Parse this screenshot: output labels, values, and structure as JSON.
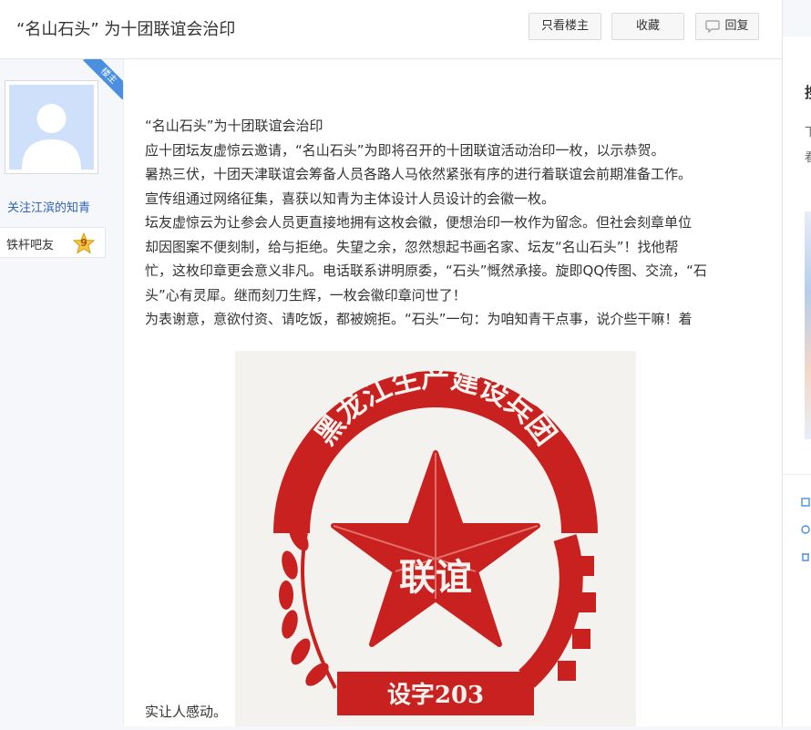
{
  "header": {
    "title": "“名山石头” 为十团联谊会治印",
    "btn_only_op": "只看楼主",
    "btn_favorite": "收藏",
    "btn_reply": "回复"
  },
  "author": {
    "badge": "楼主",
    "follow_text": "关注江滨的知青",
    "level_name": "铁杆吧友",
    "level_num": "9"
  },
  "post": {
    "lines": [
      "“名山石头”为十团联谊会治印",
      "应十团坛友虚惊云邀请，“名山石头”为即将召开的十团联谊活动治印一枚，以示恭贺。",
      "暑热三伏，十团天津联谊会筹备人员各路人马依然紧张有序的进行着联谊会前期准备工作。",
      "宣传组通过网络征集，喜获以知青为主体设计人员设计的会徽一枚。",
      "坛友虚惊云为让参会人员更直接地拥有这枚会徽，便想治印一枚作为留念。但社会刻章单位",
      "却因图案不便刻制，给与拒绝。失望之余，忽然想起书画名家、坛友“名山石头”！找他帮",
      "忙，这枚印章更会意义非凡。电话联系讲明原委，“石头”慨然承接。旋即QQ传图、交流，“石",
      "头”心有灵犀。继而刻刀生辉，一枚会徽印章问世了！",
      "为表谢意，意欲付资、请吃饭，都被婉拒。“石头”一句：为咱知青干点事，说介些干嘛！着"
    ],
    "last_line": "实让人感动。"
  },
  "seal": {
    "arc_text": "黑龙江生产建设兵团",
    "center_text": "联谊",
    "bottom_text": "设字203",
    "color": "#c8211f"
  },
  "right_panel": {
    "heading_char": "搜",
    "line1": "下",
    "line2": "看"
  }
}
